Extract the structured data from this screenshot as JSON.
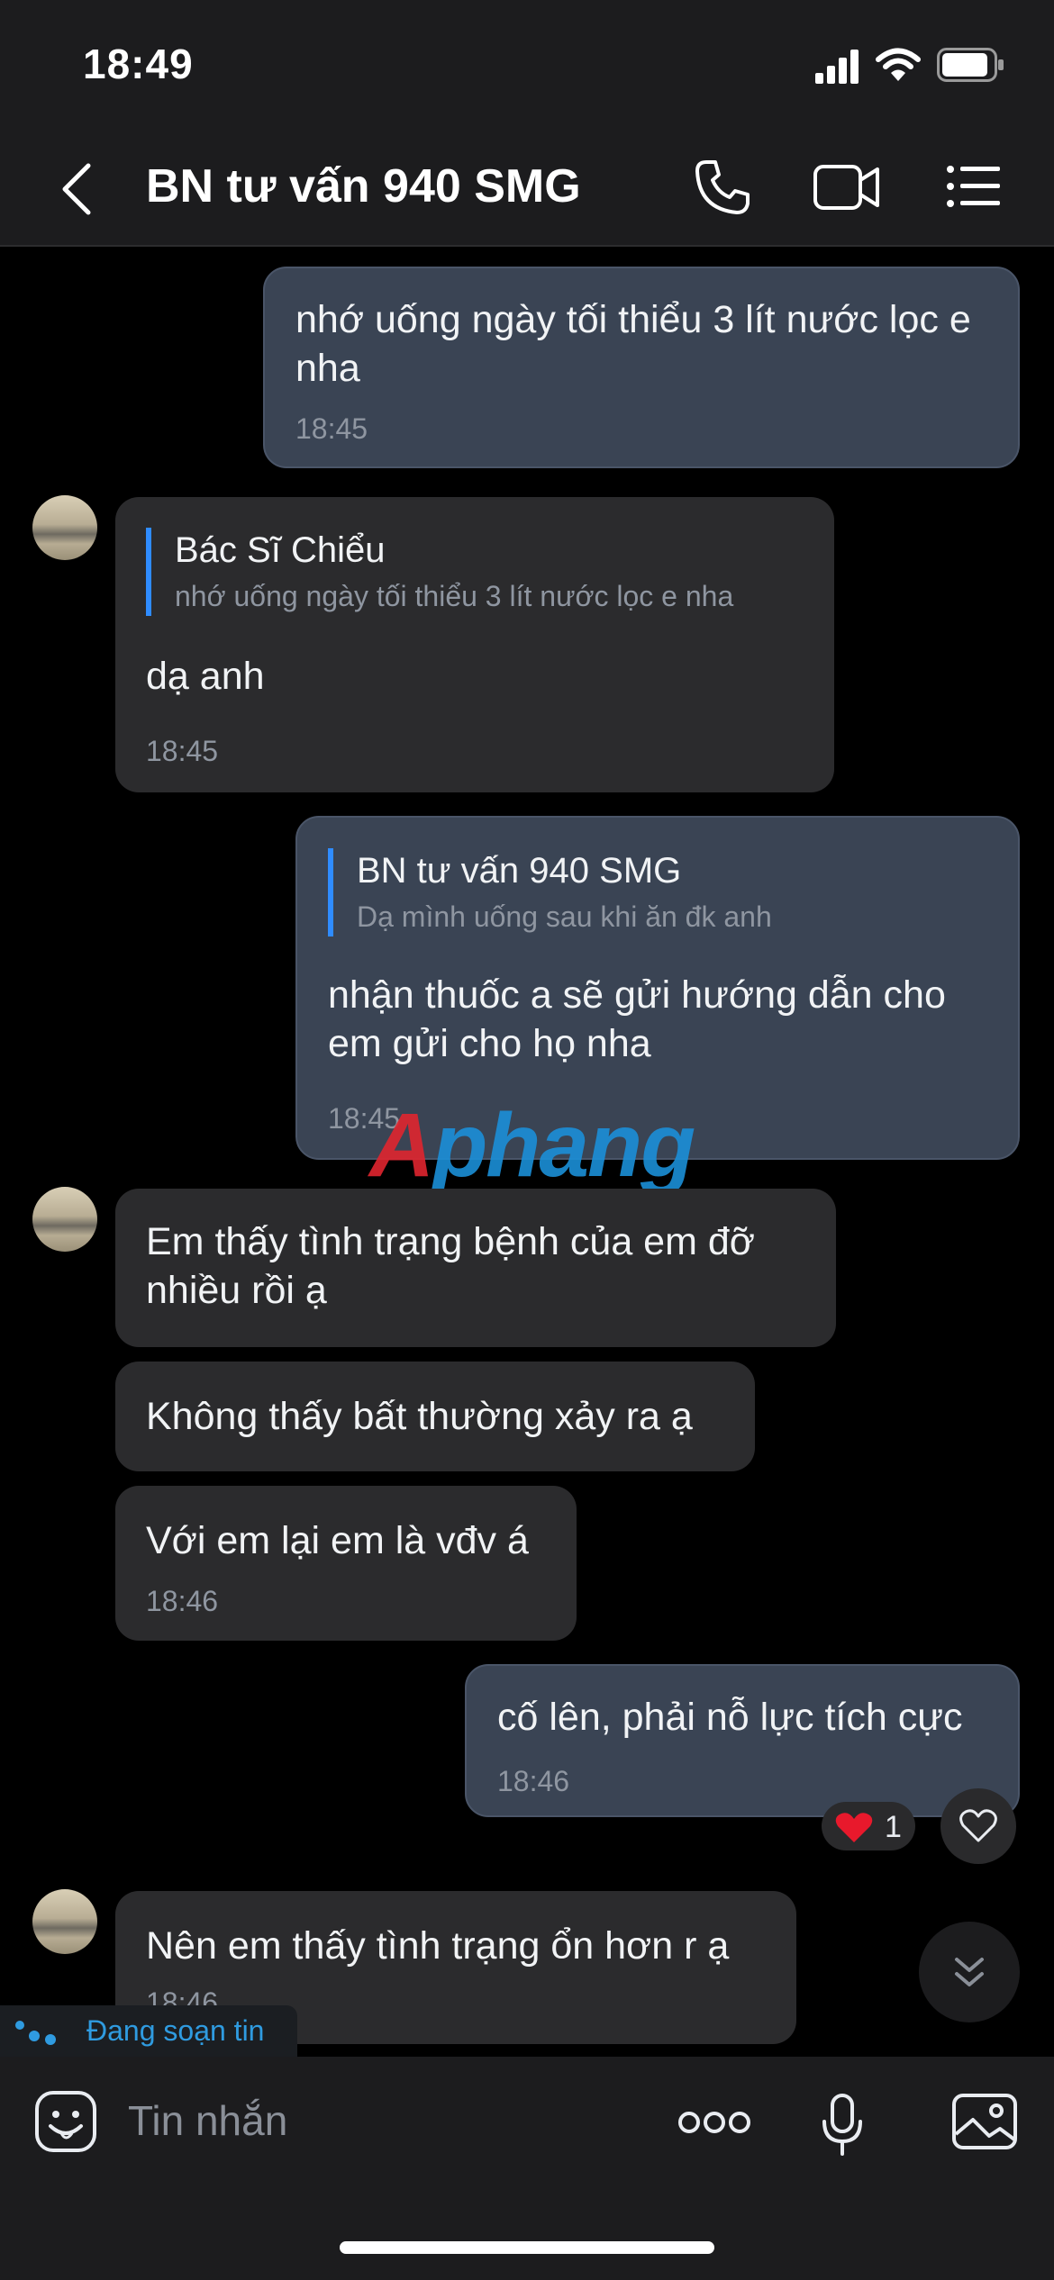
{
  "status_bar": {
    "time": "18:49"
  },
  "header": {
    "title": "BN tư vấn 940 SMG"
  },
  "messages": [
    {
      "text": "nhớ uống ngày tối thiểu 3 lít nước lọc e nha",
      "time": "18:45"
    },
    {
      "quote_name": "Bác Sĩ Chiểu",
      "quote_text": "nhớ uống ngày tối thiểu 3 lít nước lọc e nha",
      "text": "dạ anh",
      "time": "18:45"
    },
    {
      "quote_name": "BN tư vấn 940 SMG",
      "quote_text": "Dạ mình uống sau khi ăn đk anh",
      "text": "nhận thuốc a sẽ gửi hướng dẫn cho em gửi cho họ nha",
      "time": "18:45"
    },
    {
      "text": "Em thấy tình trạng bệnh của em đỡ nhiều rồi ạ"
    },
    {
      "text": "Không thấy bất thường xảy ra ạ"
    },
    {
      "text": "Với em lại em là vđv á",
      "time": "18:46"
    },
    {
      "text": "cố lên, phải nỗ lực tích cực",
      "time": "18:46",
      "reaction_count": "1"
    },
    {
      "text": "Nên em thấy tình trạng ổn hơn r ạ",
      "time": "18:46"
    }
  ],
  "typing_indicator": "Đang soạn tin",
  "composer": {
    "placeholder": "Tin nhắn"
  },
  "watermark": {
    "part1": "A",
    "part2": "phang"
  },
  "colors": {
    "accent": "#2f8cff",
    "outgoing_bubble": "#3a4454",
    "incoming_bubble": "#2b2b2d",
    "reaction_heart": "#e8192c"
  }
}
